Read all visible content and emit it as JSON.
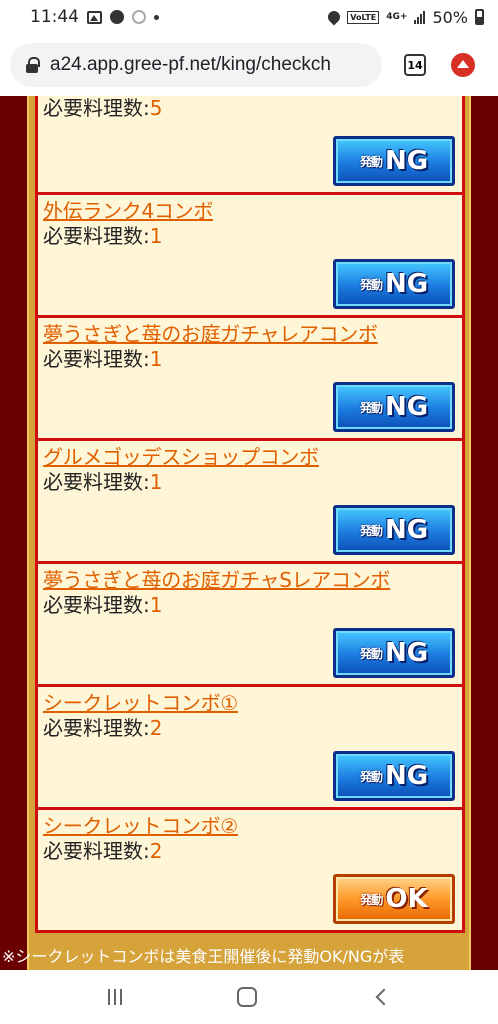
{
  "status_bar": {
    "time": "11:44",
    "network": "4G+",
    "volte": "VoLTE",
    "battery": "50%"
  },
  "browser": {
    "url": "a24.app.gree-pf.net/king/checkch",
    "tab_count": "14"
  },
  "req_label": "必要料理数:",
  "combos": [
    {
      "name": "",
      "required": "5",
      "status": "NG"
    },
    {
      "name": "外伝ランク4コンボ",
      "required": "1",
      "status": "NG"
    },
    {
      "name": "夢うさぎと苺のお庭ガチャレアコンボ",
      "required": "1",
      "status": "NG"
    },
    {
      "name": "グルメゴッデスショップコンボ",
      "required": "1",
      "status": "NG"
    },
    {
      "name": "夢うさぎと苺のお庭ガチャSレアコンボ",
      "required": "1",
      "status": "NG"
    },
    {
      "name": "シークレットコンボ①",
      "required": "2",
      "status": "NG"
    },
    {
      "name": "シークレットコンボ②",
      "required": "2",
      "status": "OK"
    }
  ],
  "button_small_label": "発動",
  "footer_note": "※シークレットコンボは美食王開催後に発動OK/NGが表"
}
